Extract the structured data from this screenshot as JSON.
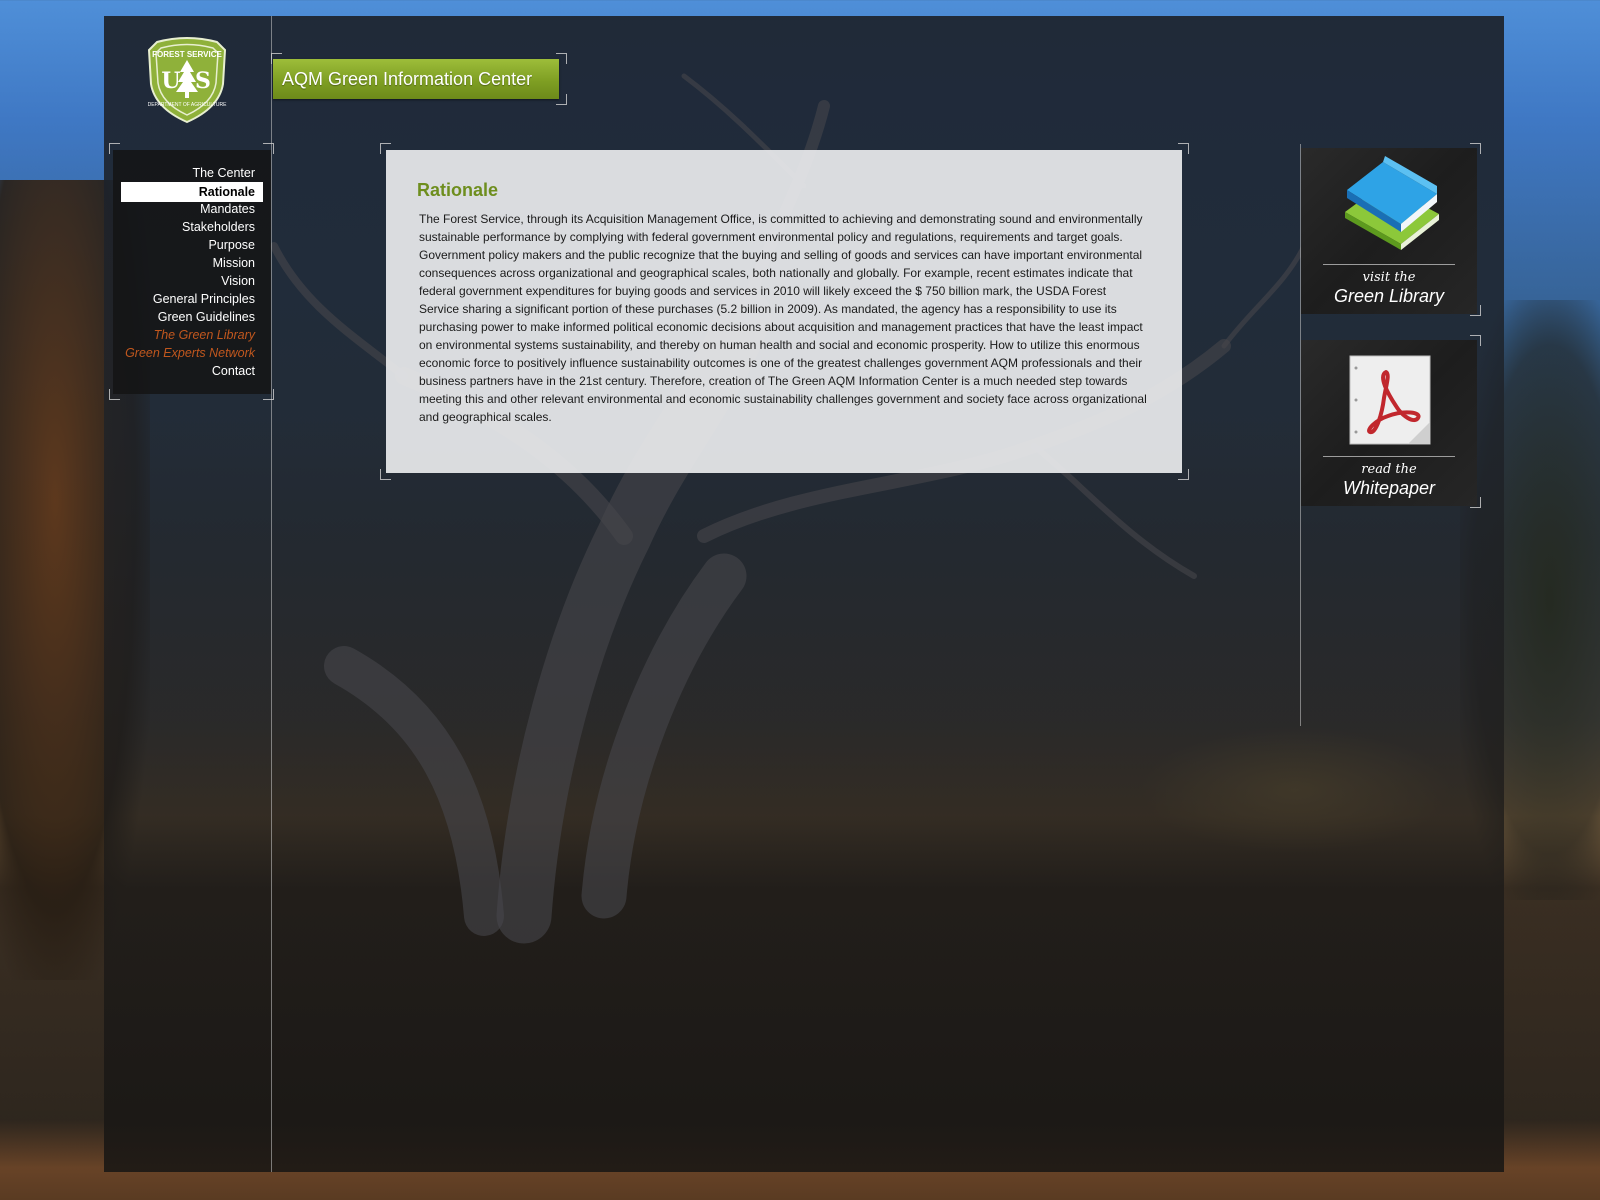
{
  "header": {
    "logo_alt": "Forest Service — U.S. Department of Agriculture",
    "title": "AQM Green Information Center"
  },
  "nav": {
    "items": [
      {
        "label": "The Center",
        "state": "normal"
      },
      {
        "label": "Rationale",
        "state": "active"
      },
      {
        "label": "Mandates",
        "state": "normal"
      },
      {
        "label": "Stakeholders",
        "state": "normal"
      },
      {
        "label": "Purpose",
        "state": "normal"
      },
      {
        "label": "Mission",
        "state": "normal"
      },
      {
        "label": "Vision",
        "state": "normal"
      },
      {
        "label": "General Principles",
        "state": "normal"
      },
      {
        "label": "Green Guidelines",
        "state": "normal"
      },
      {
        "label": "The Green Library",
        "state": "highlight"
      },
      {
        "label": "Green Experts Network",
        "state": "highlight"
      },
      {
        "label": "Contact",
        "state": "normal"
      }
    ]
  },
  "main": {
    "heading": "Rationale",
    "body": "The Forest Service, through its Acquisition Management Office, is committed to achieving and demonstrating sound and environmentally sustainable performance by complying with federal government environmental policy and regulations, requirements and target goals. Government policy makers and the public recognize that the buying and selling of goods and services can have important environmental consequences across organizational and geographical scales, both nationally and globally. For example, recent estimates indicate that federal government expenditures for buying goods and services in 2010 will likely exceed the $ 750 billion mark, the USDA Forest Service sharing a significant portion of these purchases (5.2 billion in 2009). As mandated, the agency has a responsibility to use its purchasing power to make informed political economic decisions about acquisition and management practices that have the least impact on environmental systems sustainability, and thereby on human health and social and economic prosperity. How to utilize this enormous economic force to positively influence sustainability outcomes is one of the greatest challenges government AQM professionals and their business partners have in the 21st century. Therefore, creation of The Green AQM Information Center is a much needed step towards meeting this and other relevant environmental and economic sustainability challenges government and society face across organizational and geographical scales."
  },
  "promos": {
    "library": {
      "small": "visit the",
      "big": "Green Library",
      "icon": "book-icon"
    },
    "whitepaper": {
      "small": "read the",
      "big": "Whitepaper",
      "icon": "pdf-icon"
    }
  },
  "colors": {
    "accent_green": "#7f9f23",
    "heading_green": "#6e8e1e",
    "nav_highlight": "#c0571e"
  }
}
